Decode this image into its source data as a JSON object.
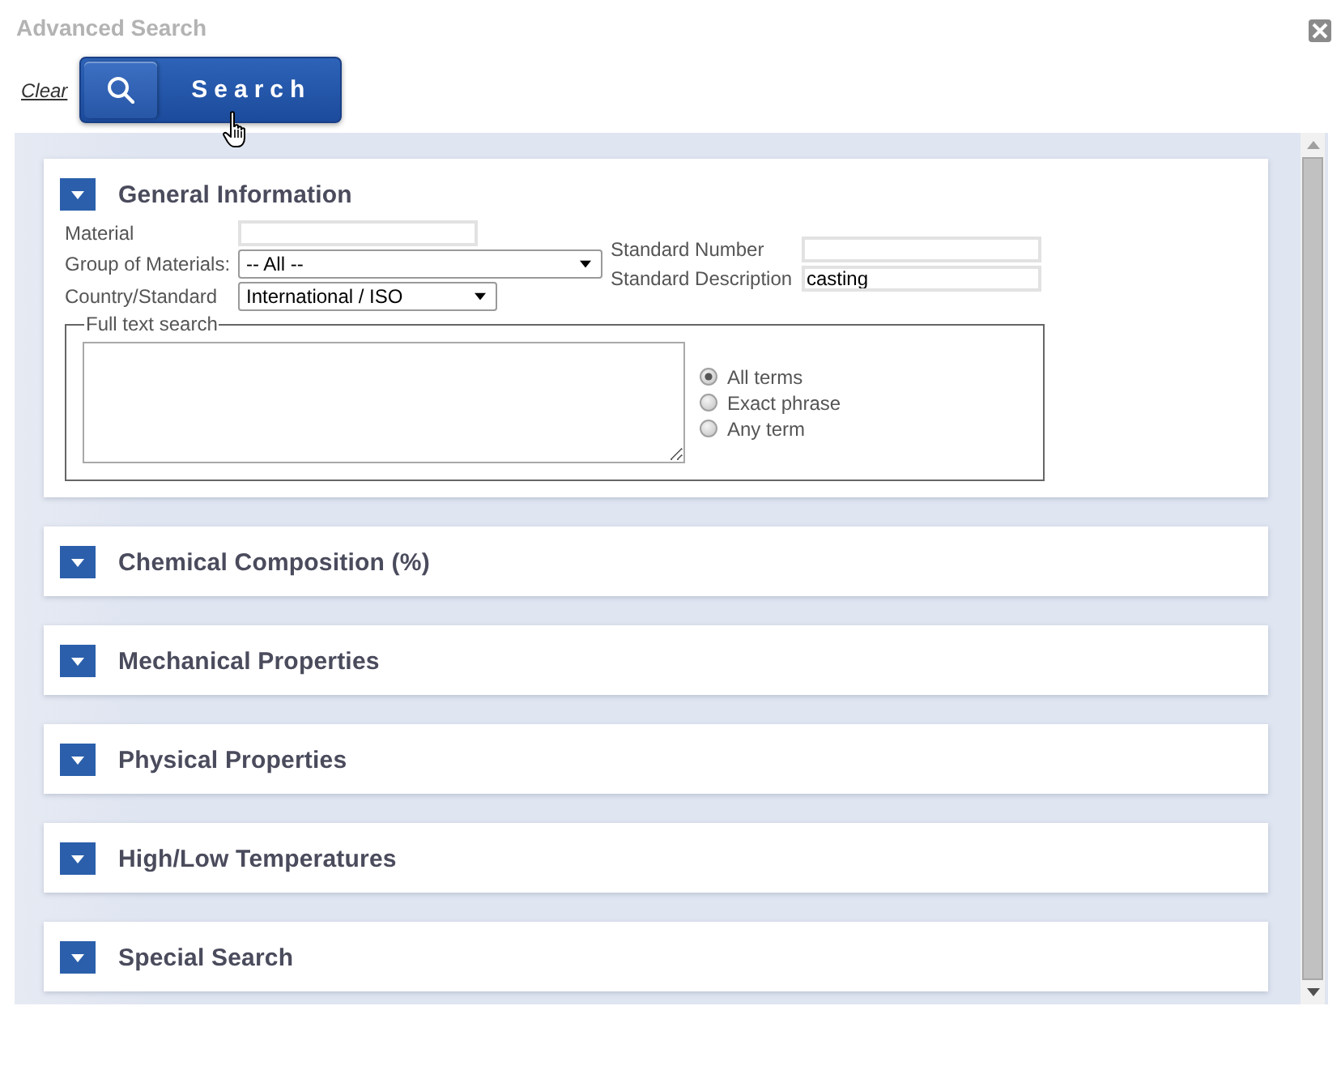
{
  "window": {
    "title": "Advanced Search"
  },
  "toolbar": {
    "clear_link": "Clear",
    "search_button": "Search"
  },
  "sections": [
    {
      "title": "General Information",
      "expanded": true,
      "form": {
        "material": {
          "label": "Material"
        },
        "group_of_materials": {
          "label": "Group of Materials:",
          "value": "-- All --"
        },
        "country_standard": {
          "label": "Country/Standard",
          "value": "International / ISO"
        },
        "standard_number": {
          "label": "Standard Number"
        },
        "standard_description": {
          "label": "Standard Description",
          "value": "casting"
        },
        "full_text_search": {
          "legend": "Full text search",
          "match_options": [
            {
              "label": "All terms",
              "selected": true
            },
            {
              "label": "Exact phrase",
              "selected": false
            },
            {
              "label": "Any term",
              "selected": false
            }
          ]
        }
      }
    },
    {
      "title": "Chemical Composition (%)",
      "expanded": false
    },
    {
      "title": "Mechanical Properties",
      "expanded": false
    },
    {
      "title": "Physical Properties",
      "expanded": false
    },
    {
      "title": "High/Low Temperatures",
      "expanded": false
    },
    {
      "title": "Special Search",
      "expanded": false
    }
  ]
}
